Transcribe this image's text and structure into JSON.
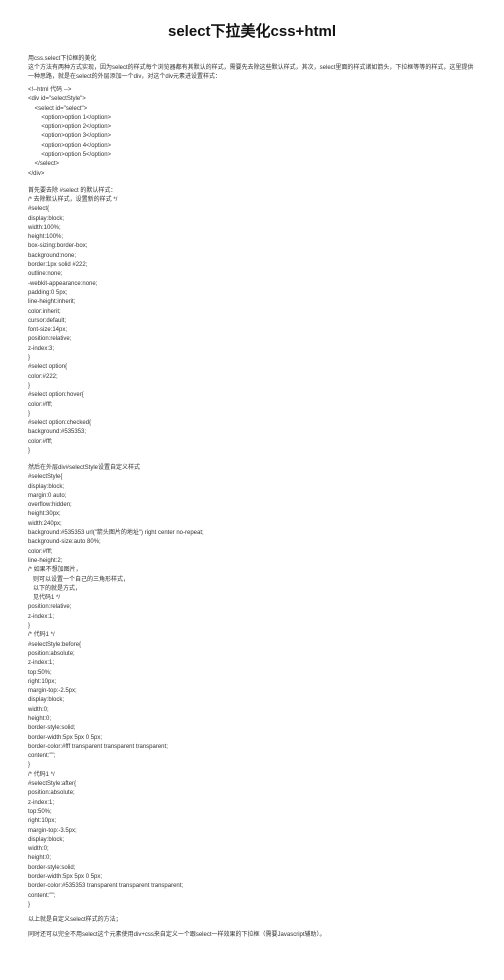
{
  "title": "select下拉美化css+html",
  "subheading1": "用css.select下拉框的美化",
  "intro": "这个方法有两种方式实现，因为select的样式每个浏览器都有其默认的样式，需要先去除这些默认样式，其次，select里面的样式诸如箭头，下拉框等等的样式，这里提供一种思路，就是在select的外层添加一个div，对这个div元素进设置样式：",
  "code1": [
    "<!--html 代码 -->",
    "<div id=\"selectStyle\">",
    "    <select id=\"select\">",
    "        <option>option 1</option>",
    "        <option>option 2</option>",
    "        <option>option 3</option>",
    "        <option>option 4</option>",
    "        <option>option 5</option>",
    "    </select>",
    "</div>"
  ],
  "subheading2": "首先要去除 #select 的默认样式：",
  "code2": [
    "/* 去除默认样式，设置新的样式 */",
    "#select{",
    "display:block;",
    "width:100%;",
    "height:100%;",
    "box-sizing:border-box;",
    "background:none;",
    "border:1px solid #222;",
    "outline:none;",
    "-webkit-appearance:none;",
    "padding:0 5px;",
    "line-height:inherit;",
    "color:inherit;",
    "cursor:default;",
    "font-size:14px;",
    "position:relative;",
    "z-index:3;",
    "}",
    "#select option{",
    "color:#222;",
    "}",
    "#select option:hover{",
    "color:#fff;",
    "}",
    "#select option:checked{",
    "background:#535353;",
    "color:#fff;",
    "}"
  ],
  "subheading3": "然后在外层div#selectStyle设置自定义样式",
  "code3": [
    "#selectStyle{",
    "display:block;",
    "margin:0 auto;",
    "overflow:hidden;",
    "height:30px;",
    "width:240px;",
    "background:#535353 url(\"箭头图片的地址\") right center no-repeat;",
    "background-size:auto 80%;",
    "color:#fff;",
    "line-height:2;",
    "/* 如果不想加图片，",
    "   则可以设置一个自己的三角形样式，",
    "   以下的就是方式，",
    "   见代码1 */",
    "position:relative;",
    "z-index:1;",
    "}",
    "/* 代码1 */",
    "#selectStyle:before{",
    "position:absolute;",
    "z-index:1;",
    "top:50%;",
    "right:10px;",
    "margin-top:-2.5px;",
    "display:block;",
    "width:0;",
    "height:0;",
    "border-style:solid;",
    "border-width:5px 5px 0 5px;",
    "border-color:#fff transparent transparent transparent;",
    "content:\"\";",
    "}",
    "/* 代码1 */",
    "#selectStyle:after{",
    "position:absolute;",
    "z-index:1;",
    "top:50%;",
    "right:10px;",
    "margin-top:-3.5px;",
    "display:block;",
    "width:0;",
    "height:0;",
    "border-style:solid;",
    "border-width:5px 5px 0 5px;",
    "border-color:#535353 transparent transparent transparent;",
    "content:\"\";",
    "}"
  ],
  "closing1": "以上就是自定义select样式的方法；",
  "closing2": "同时还可以完全不用select这个元素使用div+css来自定义一个跟select一样效果的下拉框（需要Javascript辅助）。"
}
